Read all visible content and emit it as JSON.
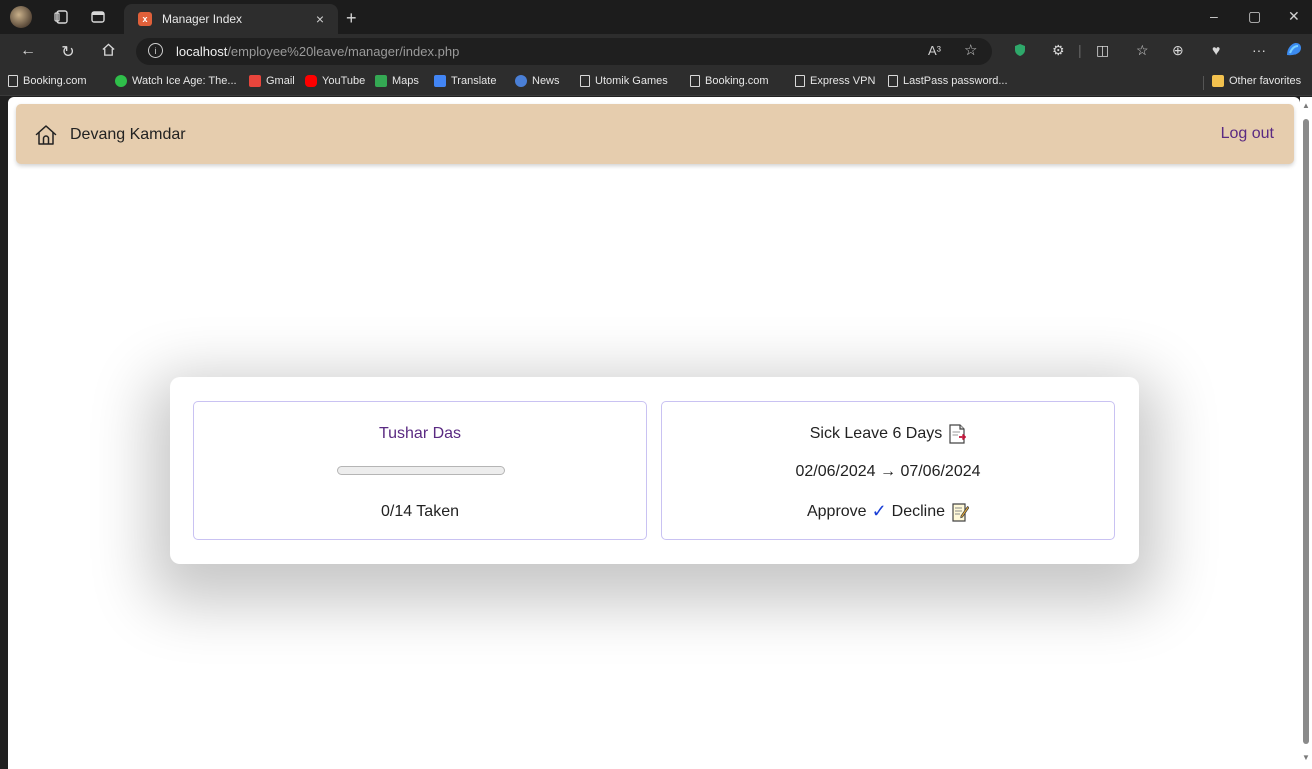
{
  "browser": {
    "tab_title": "Manager Index",
    "tab_close": "×",
    "new_tab": "+",
    "url_host": "localhost",
    "url_path": "/employee%20leave/manager/index.php",
    "read_aloud": "A³",
    "window_controls": [
      "–",
      "▢",
      "✕"
    ]
  },
  "bookmarks": [
    {
      "label": "Booking.com",
      "icon": "page-icon"
    },
    {
      "label": "Watch Ice Age: The...",
      "icon": "play-icon",
      "color": "#2fbf4a"
    },
    {
      "label": "Gmail",
      "icon": "gmail-icon",
      "color": "#e8453c"
    },
    {
      "label": "YouTube",
      "icon": "youtube-icon",
      "color": "#ff0000"
    },
    {
      "label": "Maps",
      "icon": "maps-icon",
      "color": "#34a853"
    },
    {
      "label": "Translate",
      "icon": "translate-icon",
      "color": "#4285f4"
    },
    {
      "label": "News",
      "icon": "news-icon",
      "color": "#4a7fd6"
    },
    {
      "label": "Utomik Games",
      "icon": "page-icon"
    },
    {
      "label": "Booking.com",
      "icon": "page-icon"
    },
    {
      "label": "Express VPN",
      "icon": "page-icon"
    },
    {
      "label": "LastPass password...",
      "icon": "page-icon"
    }
  ],
  "other_favorites": "Other favorites",
  "navbar": {
    "brand": "Devang Kamdar",
    "logout": "Log out",
    "bg_color": "#e6cdae"
  },
  "employee_card": {
    "name": "Tushar Das",
    "progress_fraction": 0,
    "taken_text": "0/14 Taken"
  },
  "leave_card": {
    "leave_text": "Sick Leave 6 Days",
    "date_range": "02/06/2024 → 07/06/2024",
    "approve": "Approve",
    "approve_mark": "✓",
    "decline": "Decline"
  }
}
